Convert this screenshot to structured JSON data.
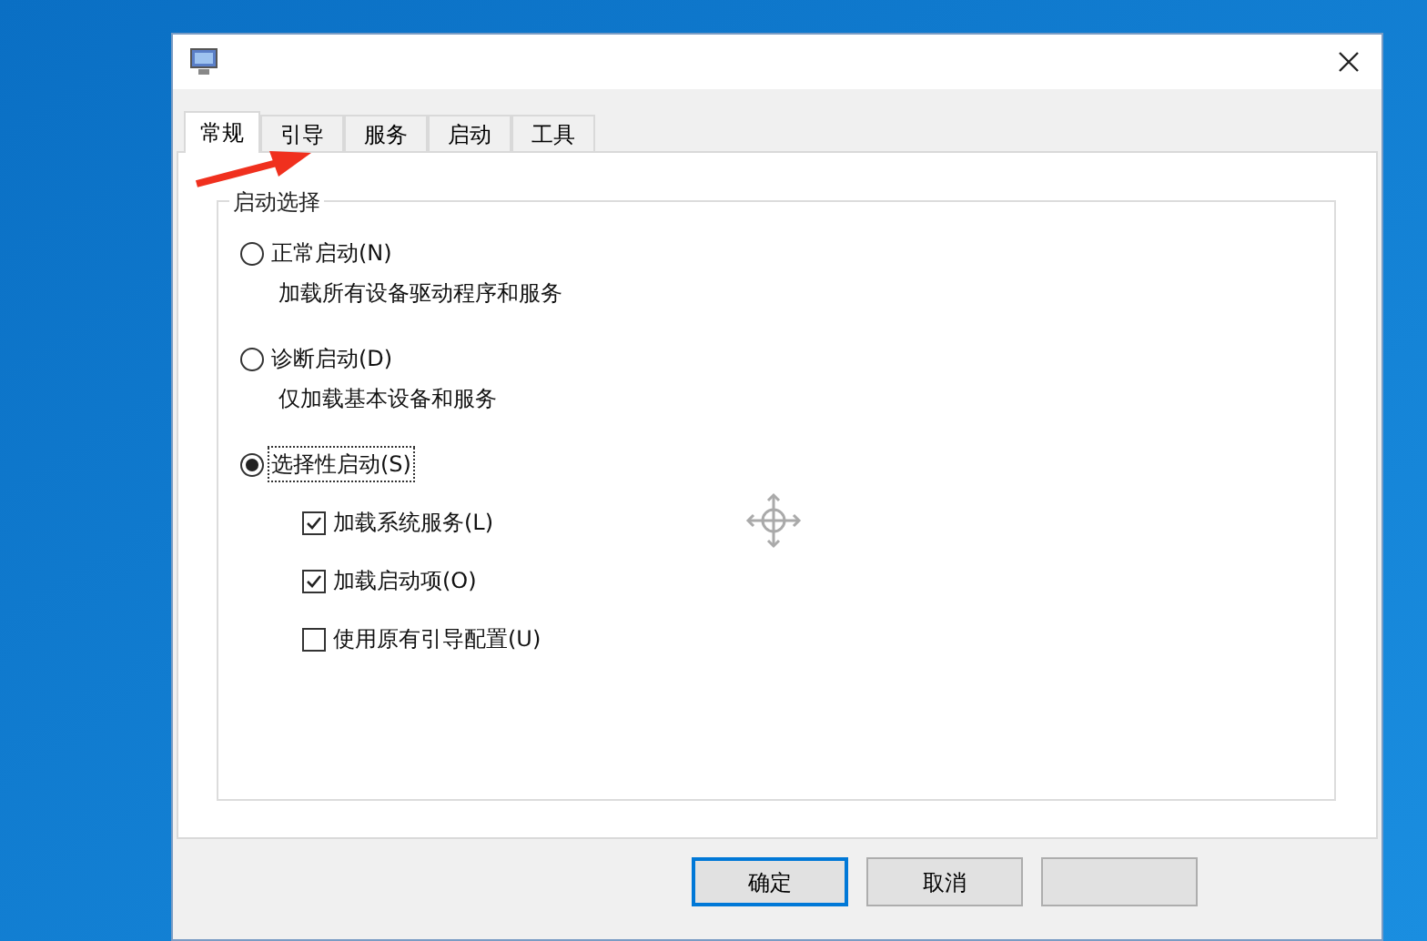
{
  "tabs": [
    {
      "label": "常规",
      "selected": true
    },
    {
      "label": "引导",
      "selected": false
    },
    {
      "label": "服务",
      "selected": false
    },
    {
      "label": "启动",
      "selected": false
    },
    {
      "label": "工具",
      "selected": false
    }
  ],
  "group": {
    "title": "启动选择",
    "options": [
      {
        "label": "正常启动(N)",
        "description": "加载所有设备驱动程序和服务",
        "selected": false,
        "focused": false
      },
      {
        "label": "诊断启动(D)",
        "description": "仅加载基本设备和服务",
        "selected": false,
        "focused": false
      },
      {
        "label": "选择性启动(S)",
        "selected": true,
        "focused": true,
        "checkboxes": [
          {
            "label": "加载系统服务(L)",
            "checked": true
          },
          {
            "label": "加载启动项(O)",
            "checked": true
          },
          {
            "label": "使用原有引导配置(U)",
            "checked": false
          }
        ]
      }
    ]
  },
  "buttons": [
    {
      "label": "确定",
      "default": true
    },
    {
      "label": "取消",
      "default": false
    },
    {
      "default": false
    }
  ]
}
